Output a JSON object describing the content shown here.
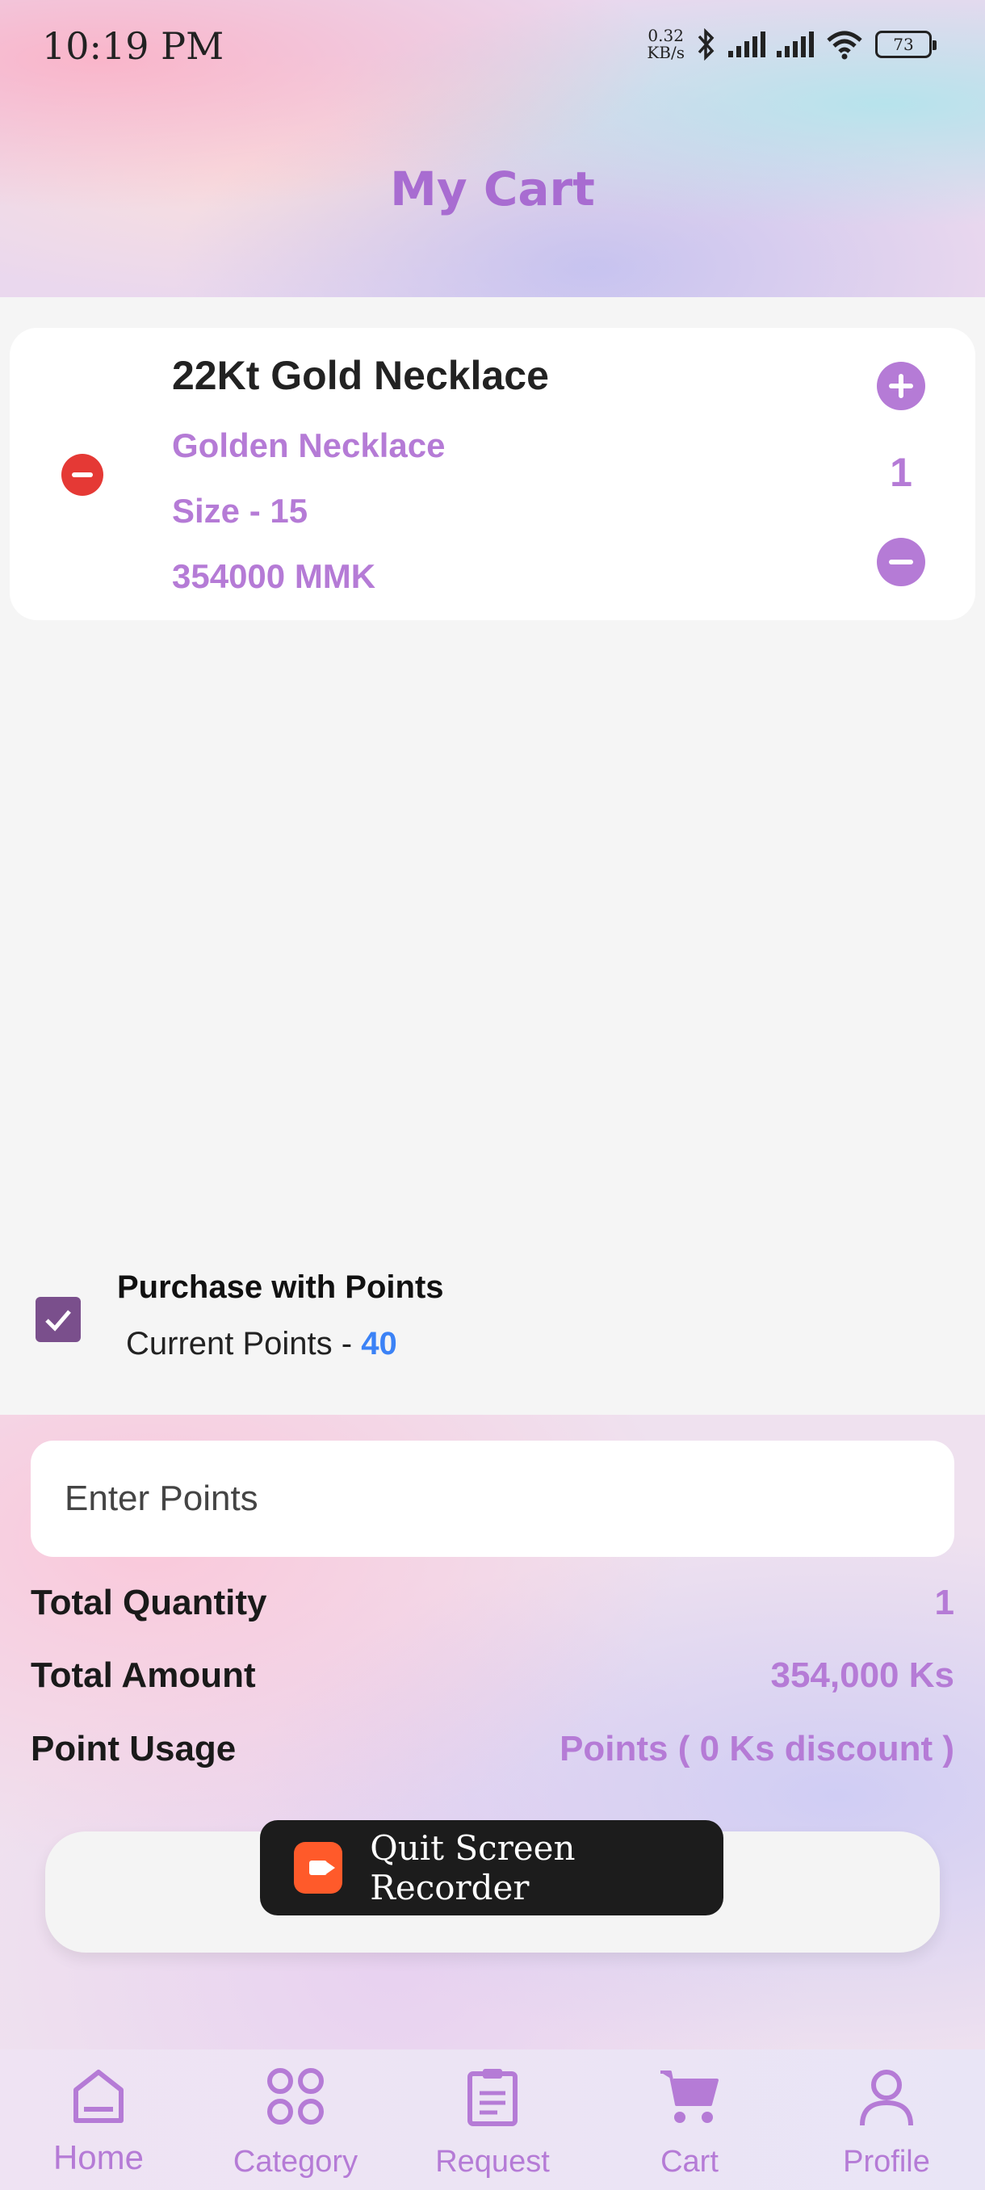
{
  "status_bar": {
    "time": "10:19 PM",
    "net_speed_value": "0.32",
    "net_speed_unit": "KB/s",
    "battery": "73"
  },
  "header": {
    "title": "My Cart"
  },
  "cart_items": [
    {
      "name": "22Kt Gold Necklace",
      "description": "Golden Necklace",
      "size": "Size - 15",
      "price": "354000 MMK",
      "quantity": "1"
    }
  ],
  "points": {
    "checkbox_checked": true,
    "title": "Purchase with Points",
    "current_label": "Current Points - ",
    "current_value": "40"
  },
  "points_input": {
    "placeholder": "Enter Points",
    "value": ""
  },
  "summary": {
    "total_quantity_label": "Total Quantity",
    "total_quantity_value": "1",
    "total_amount_label": "Total Amount",
    "total_amount_value": "354,000 Ks",
    "point_usage_label": "Point Usage",
    "point_usage_value": "Points ( 0 Ks discount )"
  },
  "overlay": {
    "recorder_label": "Quit Screen Recorder"
  },
  "bottom_nav": {
    "items": [
      {
        "label": "Home",
        "icon": "home-icon"
      },
      {
        "label": "Category",
        "icon": "category-icon"
      },
      {
        "label": "Request",
        "icon": "clipboard-icon"
      },
      {
        "label": "Cart",
        "icon": "cart-icon"
      },
      {
        "label": "Profile",
        "icon": "profile-icon"
      }
    ]
  },
  "colors": {
    "accent": "#b57bd6",
    "title": "#a86cd1",
    "remove": "#e53935",
    "checkbox": "#7a4f8c",
    "points_value": "#3b82f6"
  }
}
